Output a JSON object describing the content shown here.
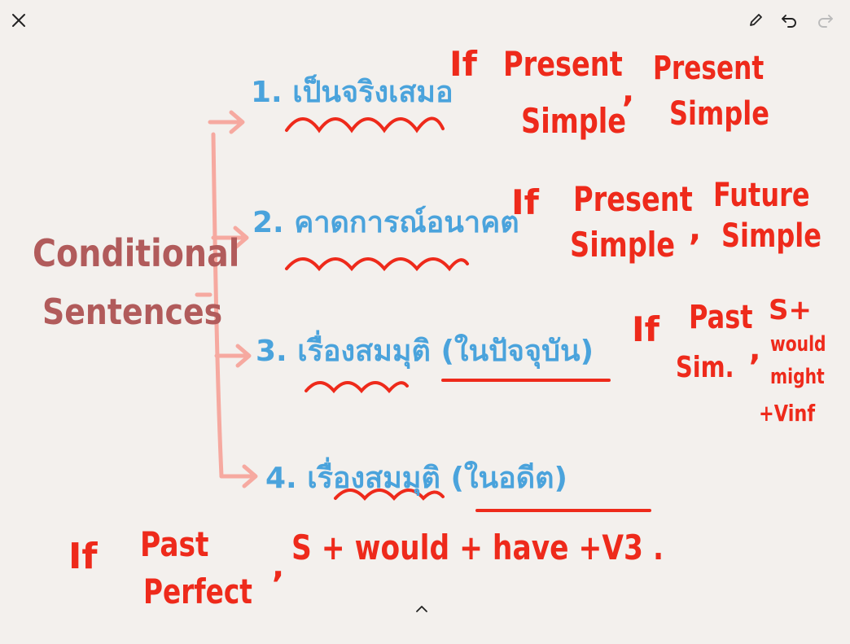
{
  "toolbar": {
    "close_icon": "close-icon",
    "pen_icon": "pencil-icon",
    "undo_icon": "undo-icon",
    "redo_icon": "redo-icon"
  },
  "colors": {
    "background": "#f3f0ed",
    "blue_ink": "#4aa3dc",
    "red_ink": "#ee2a1b",
    "brown_ink": "#b15b5b",
    "pink_bracket": "#f6a9a0"
  },
  "note": {
    "topic_line1": "Conditional",
    "topic_line2": "Sentences",
    "topic_dash": "-",
    "items": [
      {
        "label": "1. เป็นจริงเสมอ",
        "if_word": "If",
        "if_clause_line1": "Present",
        "if_clause_line2": "Simple",
        "comma": ",",
        "main_clause_line1": "Present",
        "main_clause_line2": "Simple"
      },
      {
        "label": "2. คาดการณ์อนาคต",
        "if_word": "If",
        "if_clause_line1": "Present",
        "if_clause_line2": "Simple",
        "comma": ",",
        "main_clause_line1": "Future",
        "main_clause_line2": "Simple"
      },
      {
        "label": "3. เรื่องสมมุติ (ในปัจจุบัน)",
        "if_word": "If",
        "if_clause_line1": "Past",
        "if_clause_line2": "Sim.",
        "comma": ",",
        "main_clause_line1": "S+",
        "main_clause_line2": "would",
        "main_clause_line3": "might",
        "main_clause_line4": "+Vinf"
      },
      {
        "label": "4.  เรื่องสมมุติ (ในอดีต)",
        "if_word": "If",
        "if_clause_line1": "Past",
        "if_clause_line2": "Perfect",
        "comma": ",",
        "main_clause": "S + would + have +V3 ."
      }
    ]
  },
  "footer": {
    "expand_icon": "chevron-up-icon"
  }
}
